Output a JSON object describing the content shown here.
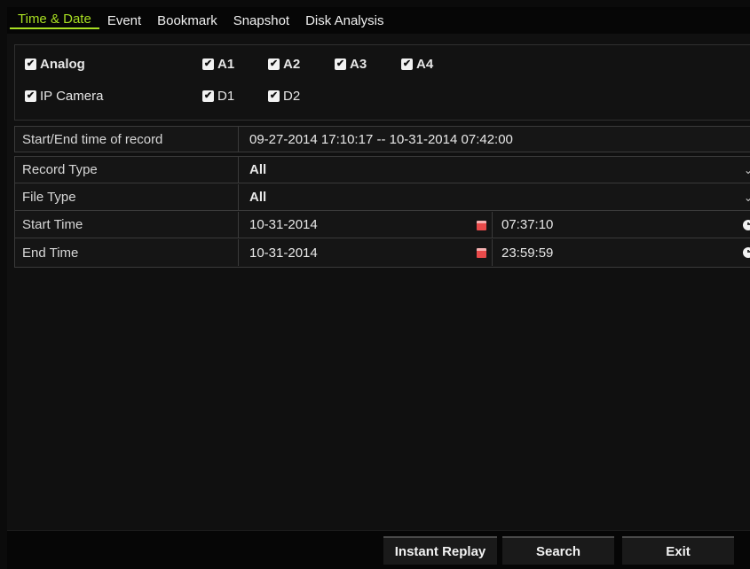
{
  "tabs": [
    {
      "label": "Time & Date",
      "active": true
    },
    {
      "label": "Event"
    },
    {
      "label": "Bookmark"
    },
    {
      "label": "Snapshot"
    },
    {
      "label": "Disk Analysis"
    }
  ],
  "cameras": {
    "analog": {
      "label": "Analog",
      "checked": true,
      "channels": [
        "A1",
        "A2",
        "A3",
        "A4"
      ]
    },
    "ip": {
      "label": "IP Camera",
      "checked": true,
      "channels": [
        "D1",
        "D2"
      ]
    }
  },
  "record_time": {
    "label": "Start/End time of record",
    "value": "09-27-2014 17:10:17 -- 10-31-2014 07:42:00"
  },
  "form": {
    "record_type": {
      "label": "Record Type",
      "value": "All"
    },
    "file_type": {
      "label": "File Type",
      "value": "All"
    },
    "start_time": {
      "label": "Start Time",
      "date": "10-31-2014",
      "time": "07:37:10"
    },
    "end_time": {
      "label": "End Time",
      "date": "10-31-2014",
      "time": "23:59:59"
    }
  },
  "buttons": {
    "instant_replay": "Instant Replay",
    "search": "Search",
    "exit": "Exit"
  },
  "colors": {
    "accent": "#a8df22",
    "background": "#101010",
    "calendar_icon": "#e84a4a"
  },
  "icons": {
    "checkbox": "check-icon",
    "calendar": "calendar-icon",
    "clock": "clock-icon",
    "dropdown": "chevron-down-icon"
  }
}
